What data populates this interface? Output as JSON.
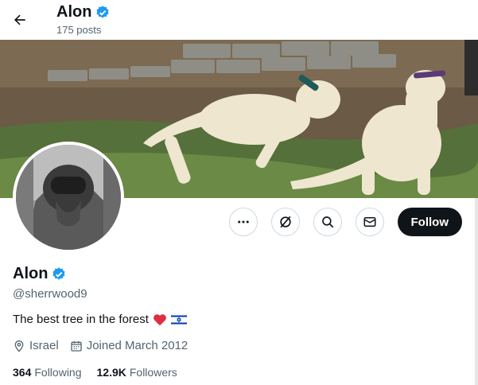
{
  "header": {
    "name": "Alon",
    "posts_count": "175 posts"
  },
  "profile": {
    "name": "Alon",
    "handle": "@sherrwood9",
    "bio_text": "The best tree in the forest",
    "bio_emojis": [
      "red-heart",
      "israel-flag"
    ],
    "location": "Israel",
    "joined": "Joined March 2012",
    "following_count": "364",
    "following_label": "Following",
    "followers_count": "12.9K",
    "followers_label": "Followers"
  },
  "actions": {
    "follow_label": "Follow",
    "icons": [
      "more-icon",
      "grok-icon",
      "search-icon",
      "message-icon"
    ]
  },
  "colors": {
    "verified_blue": "#1d9bf0",
    "follow_bg": "#0f1419",
    "secondary_text": "#536471"
  }
}
